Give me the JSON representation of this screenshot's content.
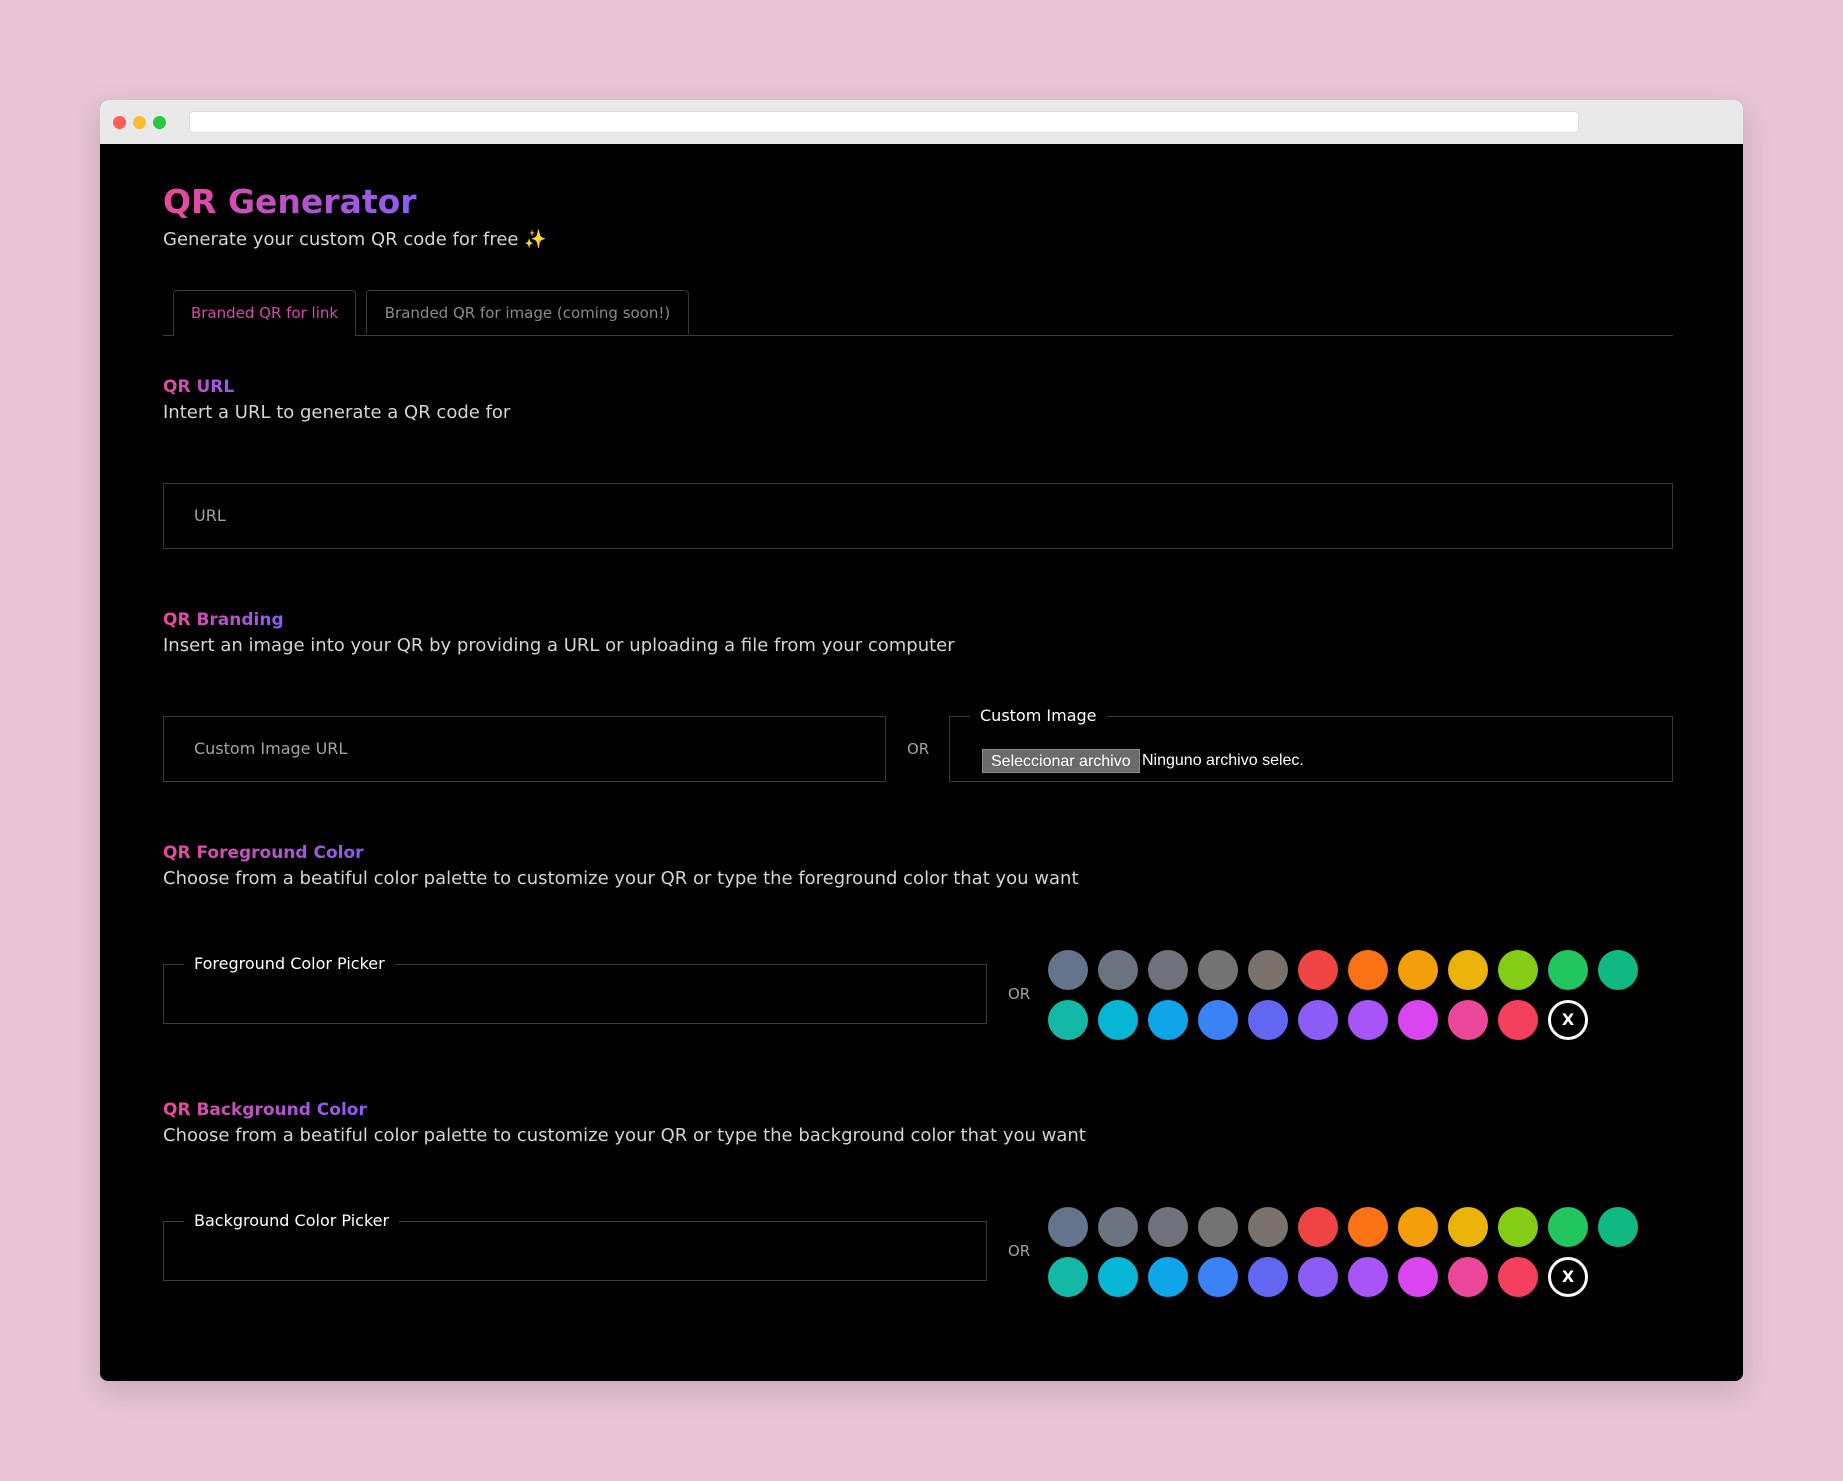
{
  "header": {
    "title": "QR Generator",
    "subtitle": "Generate your custom QR code for free ✨"
  },
  "tabs": [
    {
      "label": "Branded QR for link",
      "active": true
    },
    {
      "label": "Branded QR for image (coming soon!)",
      "active": false
    }
  ],
  "url_section": {
    "title": "QR URL",
    "description": "Intert a URL to generate a QR code for",
    "input_placeholder": "URL"
  },
  "branding_section": {
    "title": "QR Branding",
    "description": "Insert an image into your QR by providing a URL or uploading a file from your computer",
    "url_placeholder": "Custom Image URL",
    "or_label": "OR",
    "file_legend": "Custom Image",
    "file_button": "Seleccionar archivo",
    "file_status": "Ninguno archivo selec."
  },
  "foreground_section": {
    "title": "QR Foreground Color",
    "description": "Choose from a beatiful color palette to customize your QR or type the foreground color that you want",
    "picker_legend": "Foreground Color Picker",
    "or_label": "OR",
    "clear_label": "X"
  },
  "background_section": {
    "title": "QR Background Color",
    "description": "Choose from a beatiful color palette to customize your QR or type the background color that you want",
    "picker_legend": "Background Color Picker",
    "or_label": "OR",
    "clear_label": "X"
  },
  "palette_colors": [
    "#64748b",
    "#6b7280",
    "#71717a",
    "#737373",
    "#78716c",
    "#ef4444",
    "#f97316",
    "#f59e0b",
    "#eab308",
    "#84cc16",
    "#22c55e",
    "#10b981",
    "#14b8a6",
    "#06b6d4",
    "#0ea5e9",
    "#3b82f6",
    "#6366f1",
    "#8b5cf6",
    "#a855f7",
    "#d946ef",
    "#ec4899",
    "#f43f5e"
  ]
}
